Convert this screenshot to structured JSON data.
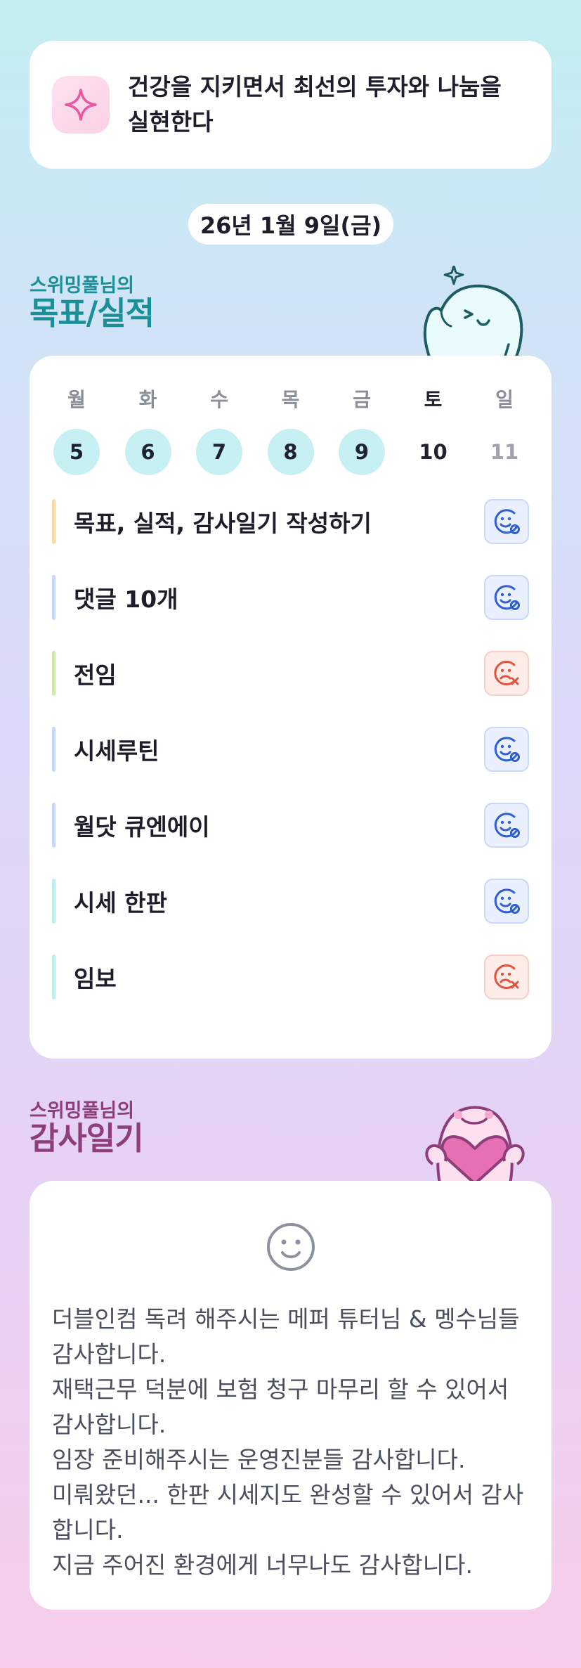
{
  "motto": {
    "icon": "sparkle-icon",
    "text": "건강을 지키면서 최선의 투자와 나눔을 실현한다"
  },
  "date": {
    "label": "26년 1월 9일(금)"
  },
  "goals_section": {
    "subtitle": "스위밍풀님의",
    "title": "목표/실적"
  },
  "week": [
    {
      "name": "월",
      "num": "5",
      "state": "done"
    },
    {
      "name": "화",
      "num": "6",
      "state": "done"
    },
    {
      "name": "수",
      "num": "7",
      "state": "done"
    },
    {
      "name": "목",
      "num": "8",
      "state": "done"
    },
    {
      "name": "금",
      "num": "9",
      "state": "done"
    },
    {
      "name": "토",
      "num": "10",
      "state": "today"
    },
    {
      "name": "일",
      "num": "11",
      "state": "future"
    }
  ],
  "tasks": [
    {
      "label": "목표, 실적, 감사일기 작성하기",
      "bar_color": "#fbd9a6",
      "status": "done"
    },
    {
      "label": "댓글 10개",
      "bar_color": "#c9d8f7",
      "status": "done"
    },
    {
      "label": "전임",
      "bar_color": "#cfe9a8",
      "status": "failed"
    },
    {
      "label": "시세루틴",
      "bar_color": "#c9d8f7",
      "status": "done"
    },
    {
      "label": "월닷 큐엔에이",
      "bar_color": "#c9d8f7",
      "status": "done"
    },
    {
      "label": "시세 한판",
      "bar_color": "#bdeef0",
      "status": "done"
    },
    {
      "label": "임보",
      "bar_color": "#bdeef0",
      "status": "failed"
    }
  ],
  "gratitude_section": {
    "subtitle": "스위밍풀님의",
    "title": "감사일기"
  },
  "gratitude": {
    "mood_icon": "smile-face-icon",
    "text": "더블인컴 독려 해주시는 메퍼 튜터님 & 멩수님들 감사합니다.\n재택근무 덕분에 보험 청구 마무리 할 수 있어서 감사합니다.\n임장 준비해주시는 운영진분들 감사합니다.\n미뤄왔던... 한판 시세지도 완성할 수 있어서 감사합니다.\n지금 주어진 환경에게 너무나도 감사합니다."
  },
  "colors": {
    "done_circle": "#c6f0f3",
    "ok_icon": "#2f5fd6",
    "fail_icon": "#e0533f",
    "goals_title": "#1b8f96",
    "gratitude_title": "#8c3d7a"
  }
}
